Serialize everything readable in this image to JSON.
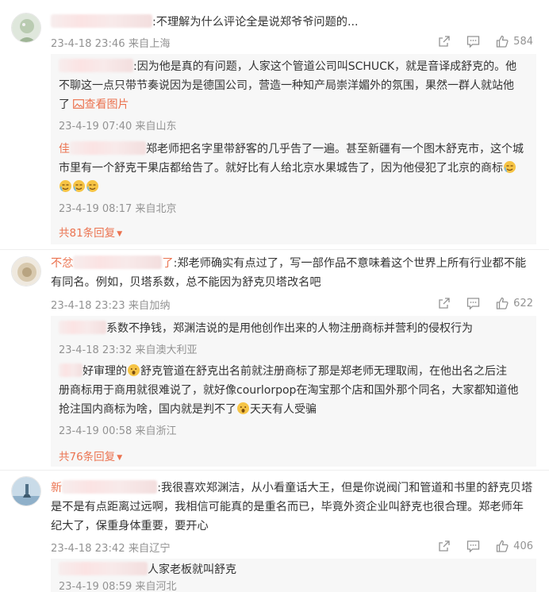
{
  "comments": [
    {
      "text": ":不理解为什么评论全是说郑爷爷问题的...",
      "time": "23-4-18 23:46",
      "location": "来自上海",
      "likes": "584",
      "replies": [
        {
          "text_a": ":因为他是真的有问题，人家这个管道公司叫SCHUCK，就是音译成舒克的。他",
          "text_b": "不聊这一点只带节奏说因为是德国公司，营造一种知产局崇洋媚外的氛围，果然一群人就站他",
          "text_c": "了",
          "image_link": "查看图片",
          "time": "23-4-19 07:40",
          "location": "来自山东"
        },
        {
          "name_prefix": "佳",
          "text_a": "郑老师把名字里带舒客的几乎告了一遍。甚至新疆有一个图木舒克市，这个城",
          "text_b": "市里有一个舒克干果店都给告了。就好比有人给北京水果城告了，因为他侵犯了北京的商标",
          "time": "23-4-19 08:17",
          "location": "来自北京"
        }
      ],
      "more_replies": "共81条回复"
    },
    {
      "name_prefix": "不忿",
      "name_suffix": "了",
      "text_a": ":郑老师确实有点过了，写一部作品不意味着这个世界上所有行业都不能",
      "text_b": "有同名。例如，贝塔系数，总不能因为舒克贝塔改名吧",
      "time": "23-4-18 23:23",
      "location": "来自加纳",
      "likes": "622",
      "replies": [
        {
          "text_a": "系数不挣钱，郑渊洁说的是用他创作出来的人物注册商标并营利的侵权行为",
          "time": "23-4-18 23:32",
          "location": "来自澳大利亚"
        },
        {
          "text_a": "好审理的",
          "text_a2": "舒克管道在舒克出名前就注册商标了那是郑老师无理取闹，在他出名之后注",
          "text_b": "册商标用于商用就很难说了，就好像courlorpop在淘宝那个店和国外那个同名，大家都知道他",
          "text_c": "抢注国内商标为啥，国内就是判不了",
          "text_c2": "天天有人受骗",
          "time": "23-4-19 00:58",
          "location": "来自浙江"
        }
      ],
      "more_replies": "共76条回复"
    },
    {
      "name_prefix": "新",
      "text_a": ":我很喜欢郑渊洁，从小看童话大王，但是你说阀门和管道和书里的舒克贝塔",
      "text_b": "是不是有点距离过远啊，我相信可能真的是重名而已，毕竟外资企业叫舒克也很合理。郑老师年",
      "text_c": "纪大了，保重身体重要，要开心",
      "time": "23-4-18 23:42",
      "location": "来自辽宁",
      "likes": "406",
      "replies": [
        {
          "text_a": "人家老板就叫舒克",
          "time": "23-4-19 08:59",
          "location": "来自河北"
        }
      ]
    }
  ],
  "colors": {
    "username": "#eb7350",
    "meta": "#939393",
    "reply_bg": "#f7f7f7"
  },
  "icons": [
    "share-icon",
    "comment-icon",
    "like-icon",
    "image-icon",
    "emoji-icon",
    "caret-down-icon"
  ]
}
